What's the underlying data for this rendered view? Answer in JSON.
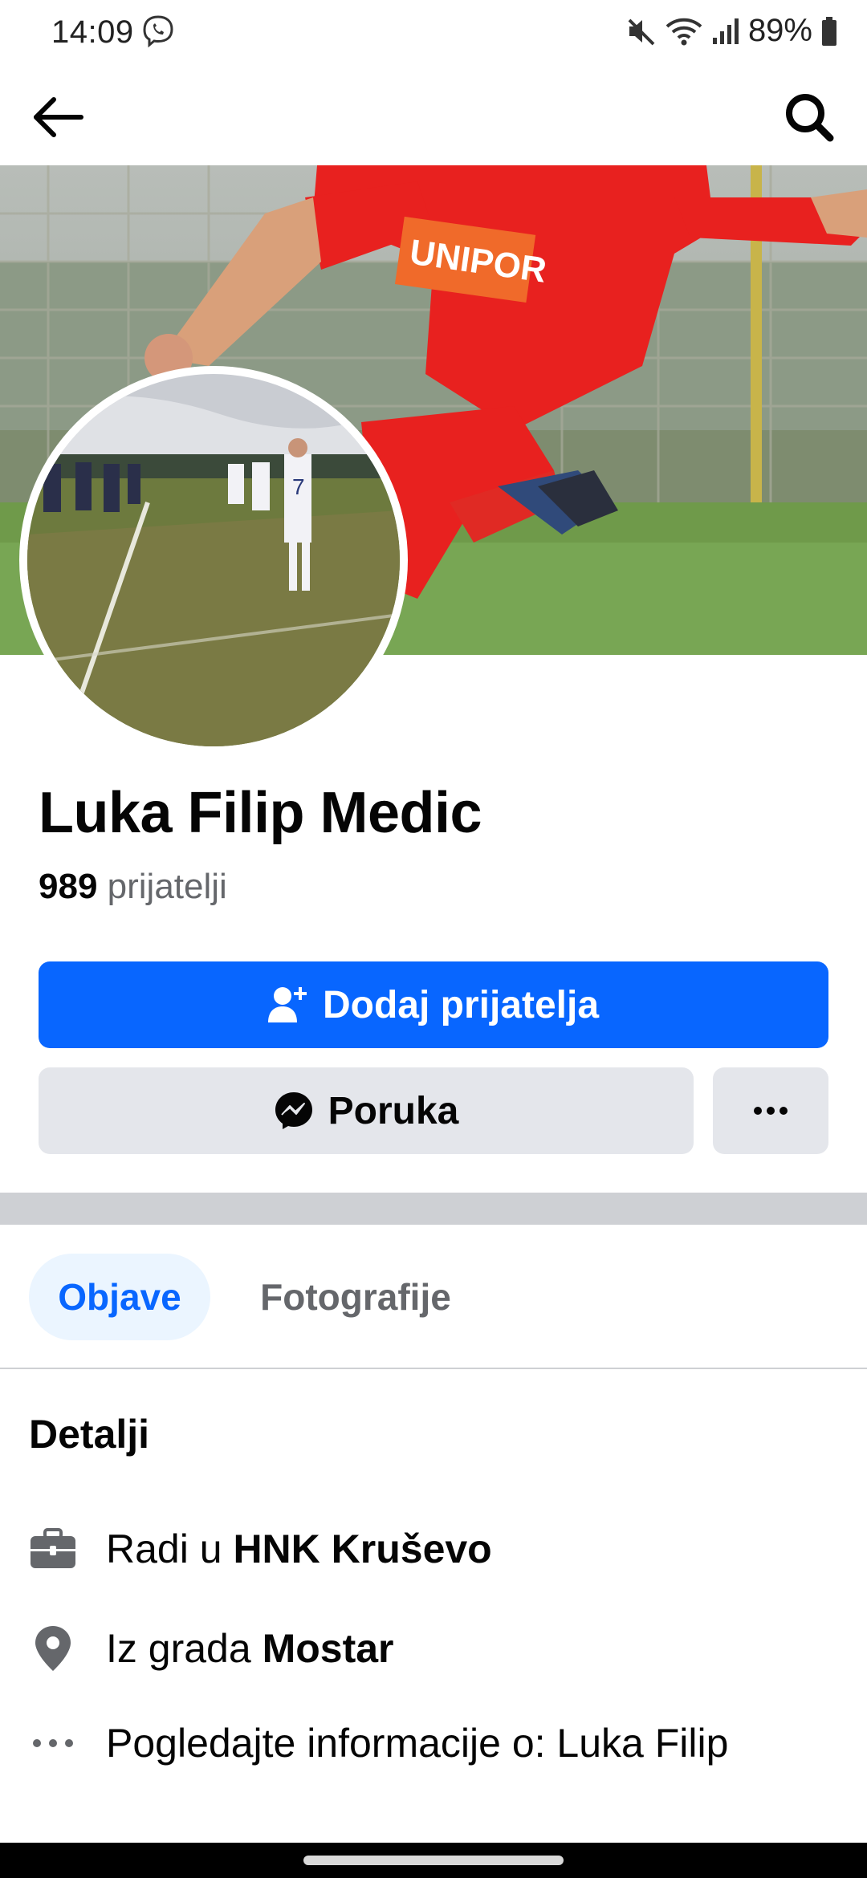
{
  "status_bar": {
    "time": "14:09",
    "battery": "89%"
  },
  "profile": {
    "name": "Luka Filip Medic",
    "friends_count": "989",
    "friends_label": "prijatelji"
  },
  "actions": {
    "add_friend_label": "Dodaj prijatelja",
    "message_label": "Poruka"
  },
  "tabs": [
    {
      "label": "Objave",
      "active": true
    },
    {
      "label": "Fotografije",
      "active": false
    }
  ],
  "details": {
    "title": "Detalji",
    "work_prefix": "Radi u",
    "work_place": "HNK Kruševo",
    "city_prefix": "Iz grada",
    "city": "Mostar",
    "more_info": "Pogledajte informacije o: Luka Filip"
  },
  "cover": {
    "shirt_text": "UNIPOR"
  },
  "colors": {
    "primary": "#0866ff",
    "secondary_button": "#e4e6eb",
    "active_tab_bg": "#ebf5ff"
  },
  "icons": [
    "back-arrow-icon",
    "search-icon",
    "add-person-icon",
    "messenger-icon",
    "more-dots-icon",
    "briefcase-icon",
    "location-pin-icon",
    "ellipsis-icon"
  ]
}
